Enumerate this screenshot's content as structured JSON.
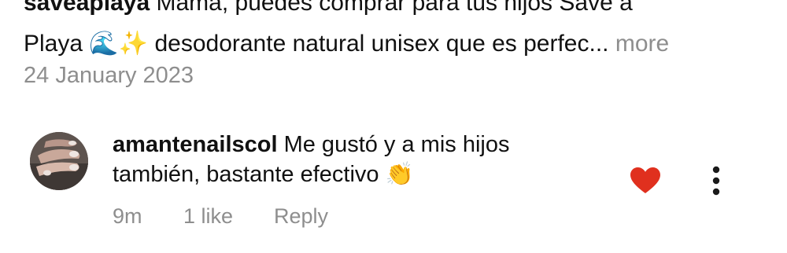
{
  "post": {
    "caption_username": "saveaplaya",
    "caption_line1": "Mamá, puedes comprar para tus hijos Save a",
    "caption_line2_start": "Playa",
    "caption_emojis": "🌊✨",
    "caption_line2_text": "desodorante natural unisex  que es perfec...",
    "more_label": "more",
    "date": "24 January 2023"
  },
  "comment": {
    "username": "amantenailscol",
    "text_line1": "Me gustó y a mis hijos",
    "text_line2": "también, bastante efectivo",
    "emoji": "👏",
    "time": "9m",
    "likes": "1 like",
    "reply_label": "Reply",
    "liked": true,
    "heart_color": "#e0301e",
    "heart_icon": "heart-filled-icon",
    "options_icon": "more-options-icon"
  }
}
